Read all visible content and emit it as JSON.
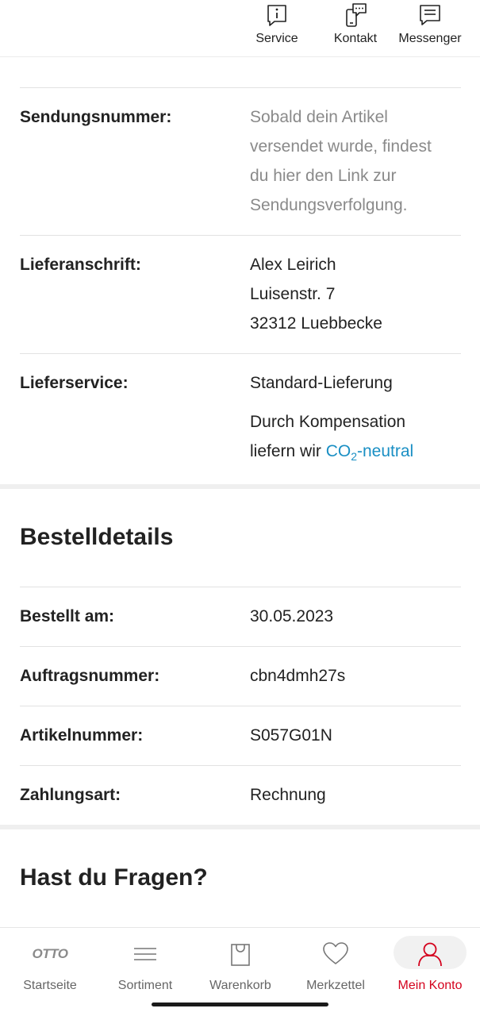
{
  "header": {
    "service_label": "Service",
    "kontakt_label": "Kontakt",
    "messenger_label": "Messenger"
  },
  "shipping": {
    "sendungsnummer_label": "Sendungsnummer:",
    "sendungsnummer_lines": [
      "Sobald dein Artikel",
      "versendet wurde, findest",
      "du hier den Link zur",
      "Sendungsverfolgung."
    ],
    "lieferanschrift_label": "Lieferanschrift:",
    "address_lines": [
      "Alex Leirich",
      "Luisenstr. 7",
      "32312 Luebbecke"
    ],
    "lieferservice_label": "Lieferservice:",
    "lieferservice_value": "Standard-Lieferung",
    "compensation_line1": "Durch Kompensation",
    "compensation_prefix": "liefern wir ",
    "co2_link_co": "CO",
    "co2_link_sub": "2",
    "co2_link_rest": "-neutral"
  },
  "bestelldetails": {
    "title": "Bestelldetails",
    "rows": [
      {
        "label": "Bestellt am:",
        "value": "30.05.2023"
      },
      {
        "label": "Auftragsnummer:",
        "value": "cbn4dmh27s"
      },
      {
        "label": "Artikelnummer:",
        "value": "S057G01N"
      },
      {
        "label": "Zahlungsart:",
        "value": "Rechnung"
      }
    ]
  },
  "fragen": {
    "title": "Hast du Fragen?"
  },
  "bottom_nav": {
    "items": [
      {
        "label": "Startseite",
        "icon": "otto-logo-icon",
        "logo_text": "OTTO"
      },
      {
        "label": "Sortiment",
        "icon": "menu-icon"
      },
      {
        "label": "Warenkorb",
        "icon": "shopping-bag-icon"
      },
      {
        "label": "Merkzettel",
        "icon": "heart-icon"
      },
      {
        "label": "Mein Konto",
        "icon": "user-icon",
        "active": true
      }
    ]
  },
  "colors": {
    "accent_red": "#d4021d",
    "link_blue": "#1a8fc4",
    "muted_text": "#8a8a8a"
  }
}
